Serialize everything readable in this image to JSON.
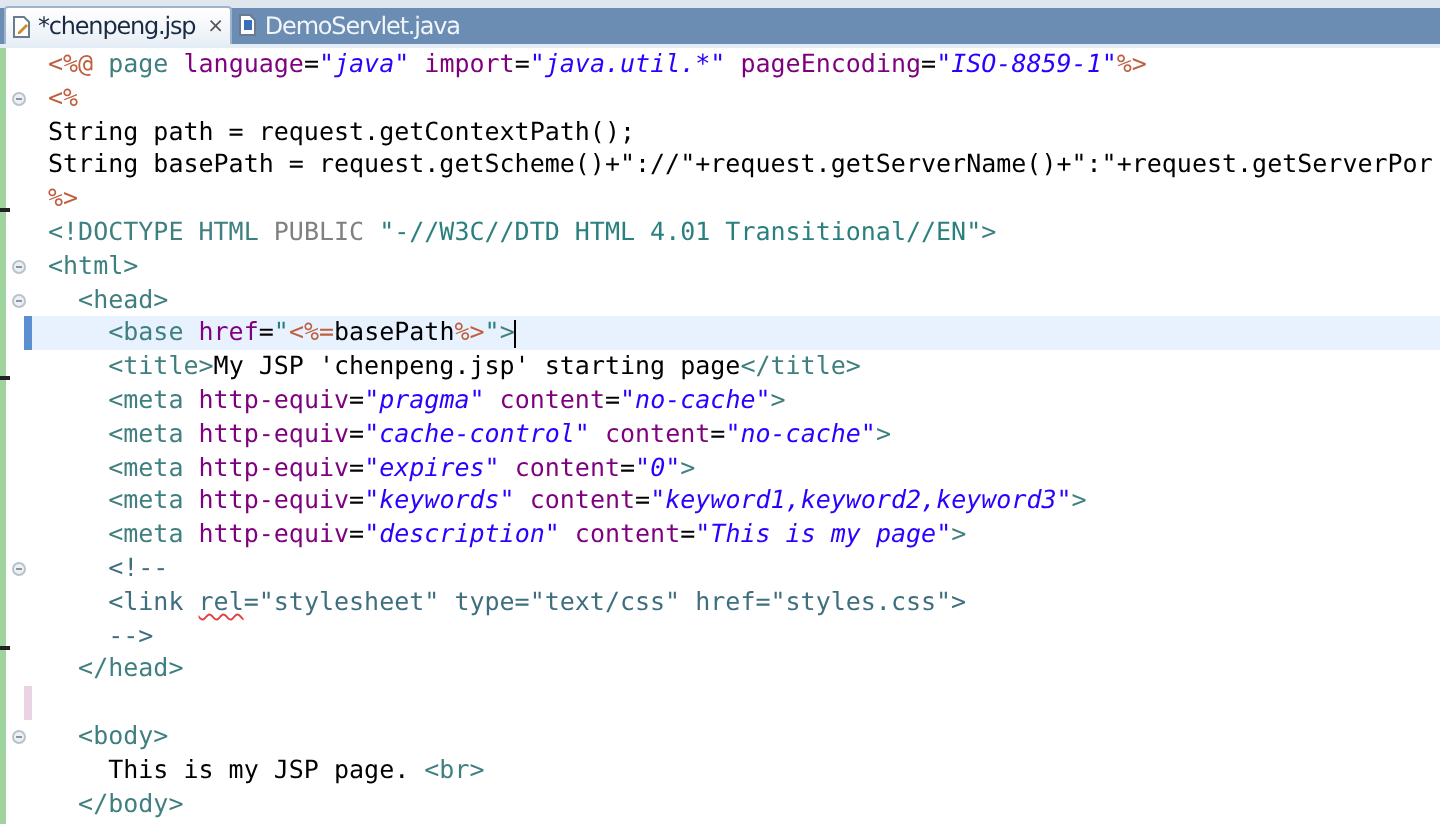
{
  "tabs": [
    {
      "label": "*chenpeng.jsp",
      "selected": true,
      "close": "×"
    },
    {
      "label": "DemoServlet.java",
      "selected": false
    }
  ],
  "editor": {
    "lines": [
      {
        "fold": false,
        "changed": false,
        "added": false,
        "removed": false,
        "current": false,
        "tokens": [
          {
            "kind": "jsp",
            "text": "<%@"
          },
          {
            "kind": "tag",
            "text": " page"
          },
          {
            "kind": "attr",
            "text": " language"
          },
          {
            "kind": "text",
            "text": "="
          },
          {
            "kind": "value",
            "text": "\"java\""
          },
          {
            "kind": "attr",
            "text": " import"
          },
          {
            "kind": "text",
            "text": "="
          },
          {
            "kind": "value",
            "text": "\"java.util.*\""
          },
          {
            "kind": "attr",
            "text": " pageEncoding"
          },
          {
            "kind": "text",
            "text": "="
          },
          {
            "kind": "value",
            "text": "\"ISO-8859-1\""
          },
          {
            "kind": "jsp",
            "text": "%>"
          }
        ]
      },
      {
        "fold": true,
        "changed": false,
        "added": false,
        "removed": false,
        "current": false,
        "tokens": [
          {
            "kind": "jsp",
            "text": "<%"
          }
        ]
      },
      {
        "fold": false,
        "changed": false,
        "added": false,
        "removed": false,
        "current": false,
        "tokens": [
          {
            "kind": "text",
            "text": "String path = request.getContextPath();"
          }
        ]
      },
      {
        "fold": false,
        "changed": false,
        "added": false,
        "removed": false,
        "current": false,
        "tokens": [
          {
            "kind": "text",
            "text": "String basePath = request.getScheme()+\"://\"+request.getServerName()+\":\"+request.getServerPor"
          }
        ]
      },
      {
        "fold": false,
        "changed": false,
        "added": false,
        "removed": true,
        "current": false,
        "tokens": [
          {
            "kind": "jsp",
            "text": "%>"
          }
        ]
      },
      {
        "fold": false,
        "changed": false,
        "added": false,
        "removed": false,
        "current": false,
        "tokens": [
          {
            "kind": "tag",
            "text": "<!DOCTYPE HTML "
          },
          {
            "kind": "keyword",
            "text": "PUBLIC "
          },
          {
            "kind": "string",
            "text": "\"-//W3C//DTD HTML 4.01 Transitional//EN\""
          },
          {
            "kind": "tag",
            "text": ">"
          }
        ]
      },
      {
        "fold": true,
        "changed": false,
        "added": false,
        "removed": false,
        "current": false,
        "tokens": [
          {
            "kind": "tag",
            "text": "<html>"
          }
        ]
      },
      {
        "fold": true,
        "changed": false,
        "added": false,
        "removed": false,
        "current": false,
        "tokens": [
          {
            "kind": "tag",
            "text": "  <head>"
          }
        ]
      },
      {
        "fold": false,
        "changed": true,
        "added": false,
        "removed": false,
        "current": true,
        "tokens": [
          {
            "kind": "tag",
            "text": "    <base"
          },
          {
            "kind": "attr",
            "text": " href"
          },
          {
            "kind": "text",
            "text": "="
          },
          {
            "kind": "string",
            "text": "\""
          },
          {
            "kind": "jsp",
            "text": "<%="
          },
          {
            "kind": "text",
            "text": "basePath"
          },
          {
            "kind": "jsp",
            "text": "%>"
          },
          {
            "kind": "string",
            "text": "\""
          },
          {
            "kind": "tag",
            "text": ">"
          }
        ]
      },
      {
        "fold": false,
        "changed": false,
        "added": false,
        "removed": true,
        "current": false,
        "tokens": [
          {
            "kind": "tag",
            "text": "    <title>"
          },
          {
            "kind": "text",
            "text": "My JSP 'chenpeng.jsp' starting page"
          },
          {
            "kind": "tag",
            "text": "</title>"
          }
        ]
      },
      {
        "fold": false,
        "changed": false,
        "added": false,
        "removed": false,
        "current": false,
        "tokens": [
          {
            "kind": "tag",
            "text": "    <meta"
          },
          {
            "kind": "attr",
            "text": " http-equiv"
          },
          {
            "kind": "text",
            "text": "="
          },
          {
            "kind": "value",
            "text": "\"pragma\""
          },
          {
            "kind": "attr",
            "text": " content"
          },
          {
            "kind": "text",
            "text": "="
          },
          {
            "kind": "value",
            "text": "\"no-cache\""
          },
          {
            "kind": "tag",
            "text": ">"
          }
        ]
      },
      {
        "fold": false,
        "changed": false,
        "added": false,
        "removed": false,
        "current": false,
        "tokens": [
          {
            "kind": "tag",
            "text": "    <meta"
          },
          {
            "kind": "attr",
            "text": " http-equiv"
          },
          {
            "kind": "text",
            "text": "="
          },
          {
            "kind": "value",
            "text": "\"cache-control\""
          },
          {
            "kind": "attr",
            "text": " content"
          },
          {
            "kind": "text",
            "text": "="
          },
          {
            "kind": "value",
            "text": "\"no-cache\""
          },
          {
            "kind": "tag",
            "text": ">"
          }
        ]
      },
      {
        "fold": false,
        "changed": false,
        "added": false,
        "removed": false,
        "current": false,
        "tokens": [
          {
            "kind": "tag",
            "text": "    <meta"
          },
          {
            "kind": "attr",
            "text": " http-equiv"
          },
          {
            "kind": "text",
            "text": "="
          },
          {
            "kind": "value",
            "text": "\"expires\""
          },
          {
            "kind": "attr",
            "text": " content"
          },
          {
            "kind": "text",
            "text": "="
          },
          {
            "kind": "value",
            "text": "\"0\""
          },
          {
            "kind": "tag",
            "text": ">"
          }
        ]
      },
      {
        "fold": false,
        "changed": false,
        "added": false,
        "removed": false,
        "current": false,
        "tokens": [
          {
            "kind": "tag",
            "text": "    <meta"
          },
          {
            "kind": "attr",
            "text": " http-equiv"
          },
          {
            "kind": "text",
            "text": "="
          },
          {
            "kind": "value",
            "text": "\"keywords\""
          },
          {
            "kind": "attr",
            "text": " content"
          },
          {
            "kind": "text",
            "text": "="
          },
          {
            "kind": "value",
            "text": "\"keyword1,keyword2,keyword3\""
          },
          {
            "kind": "tag",
            "text": ">"
          }
        ]
      },
      {
        "fold": false,
        "changed": false,
        "added": false,
        "removed": false,
        "current": false,
        "tokens": [
          {
            "kind": "tag",
            "text": "    <meta"
          },
          {
            "kind": "attr",
            "text": " http-equiv"
          },
          {
            "kind": "text",
            "text": "="
          },
          {
            "kind": "value",
            "text": "\"description\""
          },
          {
            "kind": "attr",
            "text": " content"
          },
          {
            "kind": "text",
            "text": "="
          },
          {
            "kind": "value",
            "text": "\"This is my page\""
          },
          {
            "kind": "tag",
            "text": ">"
          }
        ]
      },
      {
        "fold": true,
        "changed": false,
        "added": false,
        "removed": false,
        "current": false,
        "tokens": [
          {
            "kind": "comment",
            "text": "    <!--"
          }
        ]
      },
      {
        "fold": false,
        "changed": false,
        "added": false,
        "removed": false,
        "current": false,
        "tokens": [
          {
            "kind": "comment",
            "text": "    <link "
          },
          {
            "kind": "squiggle",
            "text": "rel"
          },
          {
            "kind": "comment",
            "text": "=\"stylesheet\" type=\"text/css\" href=\"styles.css\">"
          }
        ]
      },
      {
        "fold": false,
        "changed": false,
        "added": false,
        "removed": true,
        "current": false,
        "tokens": [
          {
            "kind": "comment",
            "text": "    -->"
          }
        ]
      },
      {
        "fold": false,
        "changed": false,
        "added": false,
        "removed": false,
        "current": false,
        "tokens": [
          {
            "kind": "tag",
            "text": "  </head>"
          }
        ]
      },
      {
        "fold": false,
        "changed": false,
        "added": true,
        "removed": false,
        "current": false
      },
      {
        "fold": true,
        "changed": false,
        "added": false,
        "removed": false,
        "current": false,
        "tokens": [
          {
            "kind": "tag",
            "text": "  <body>"
          }
        ]
      },
      {
        "fold": false,
        "changed": false,
        "added": false,
        "removed": false,
        "current": false,
        "tokens": [
          {
            "kind": "text",
            "text": "    This is my JSP page. "
          },
          {
            "kind": "tag",
            "text": "<br>"
          }
        ]
      },
      {
        "fold": false,
        "changed": false,
        "added": false,
        "removed": false,
        "current": false,
        "tokens": [
          {
            "kind": "tag",
            "text": "  </body>"
          }
        ]
      }
    ]
  }
}
